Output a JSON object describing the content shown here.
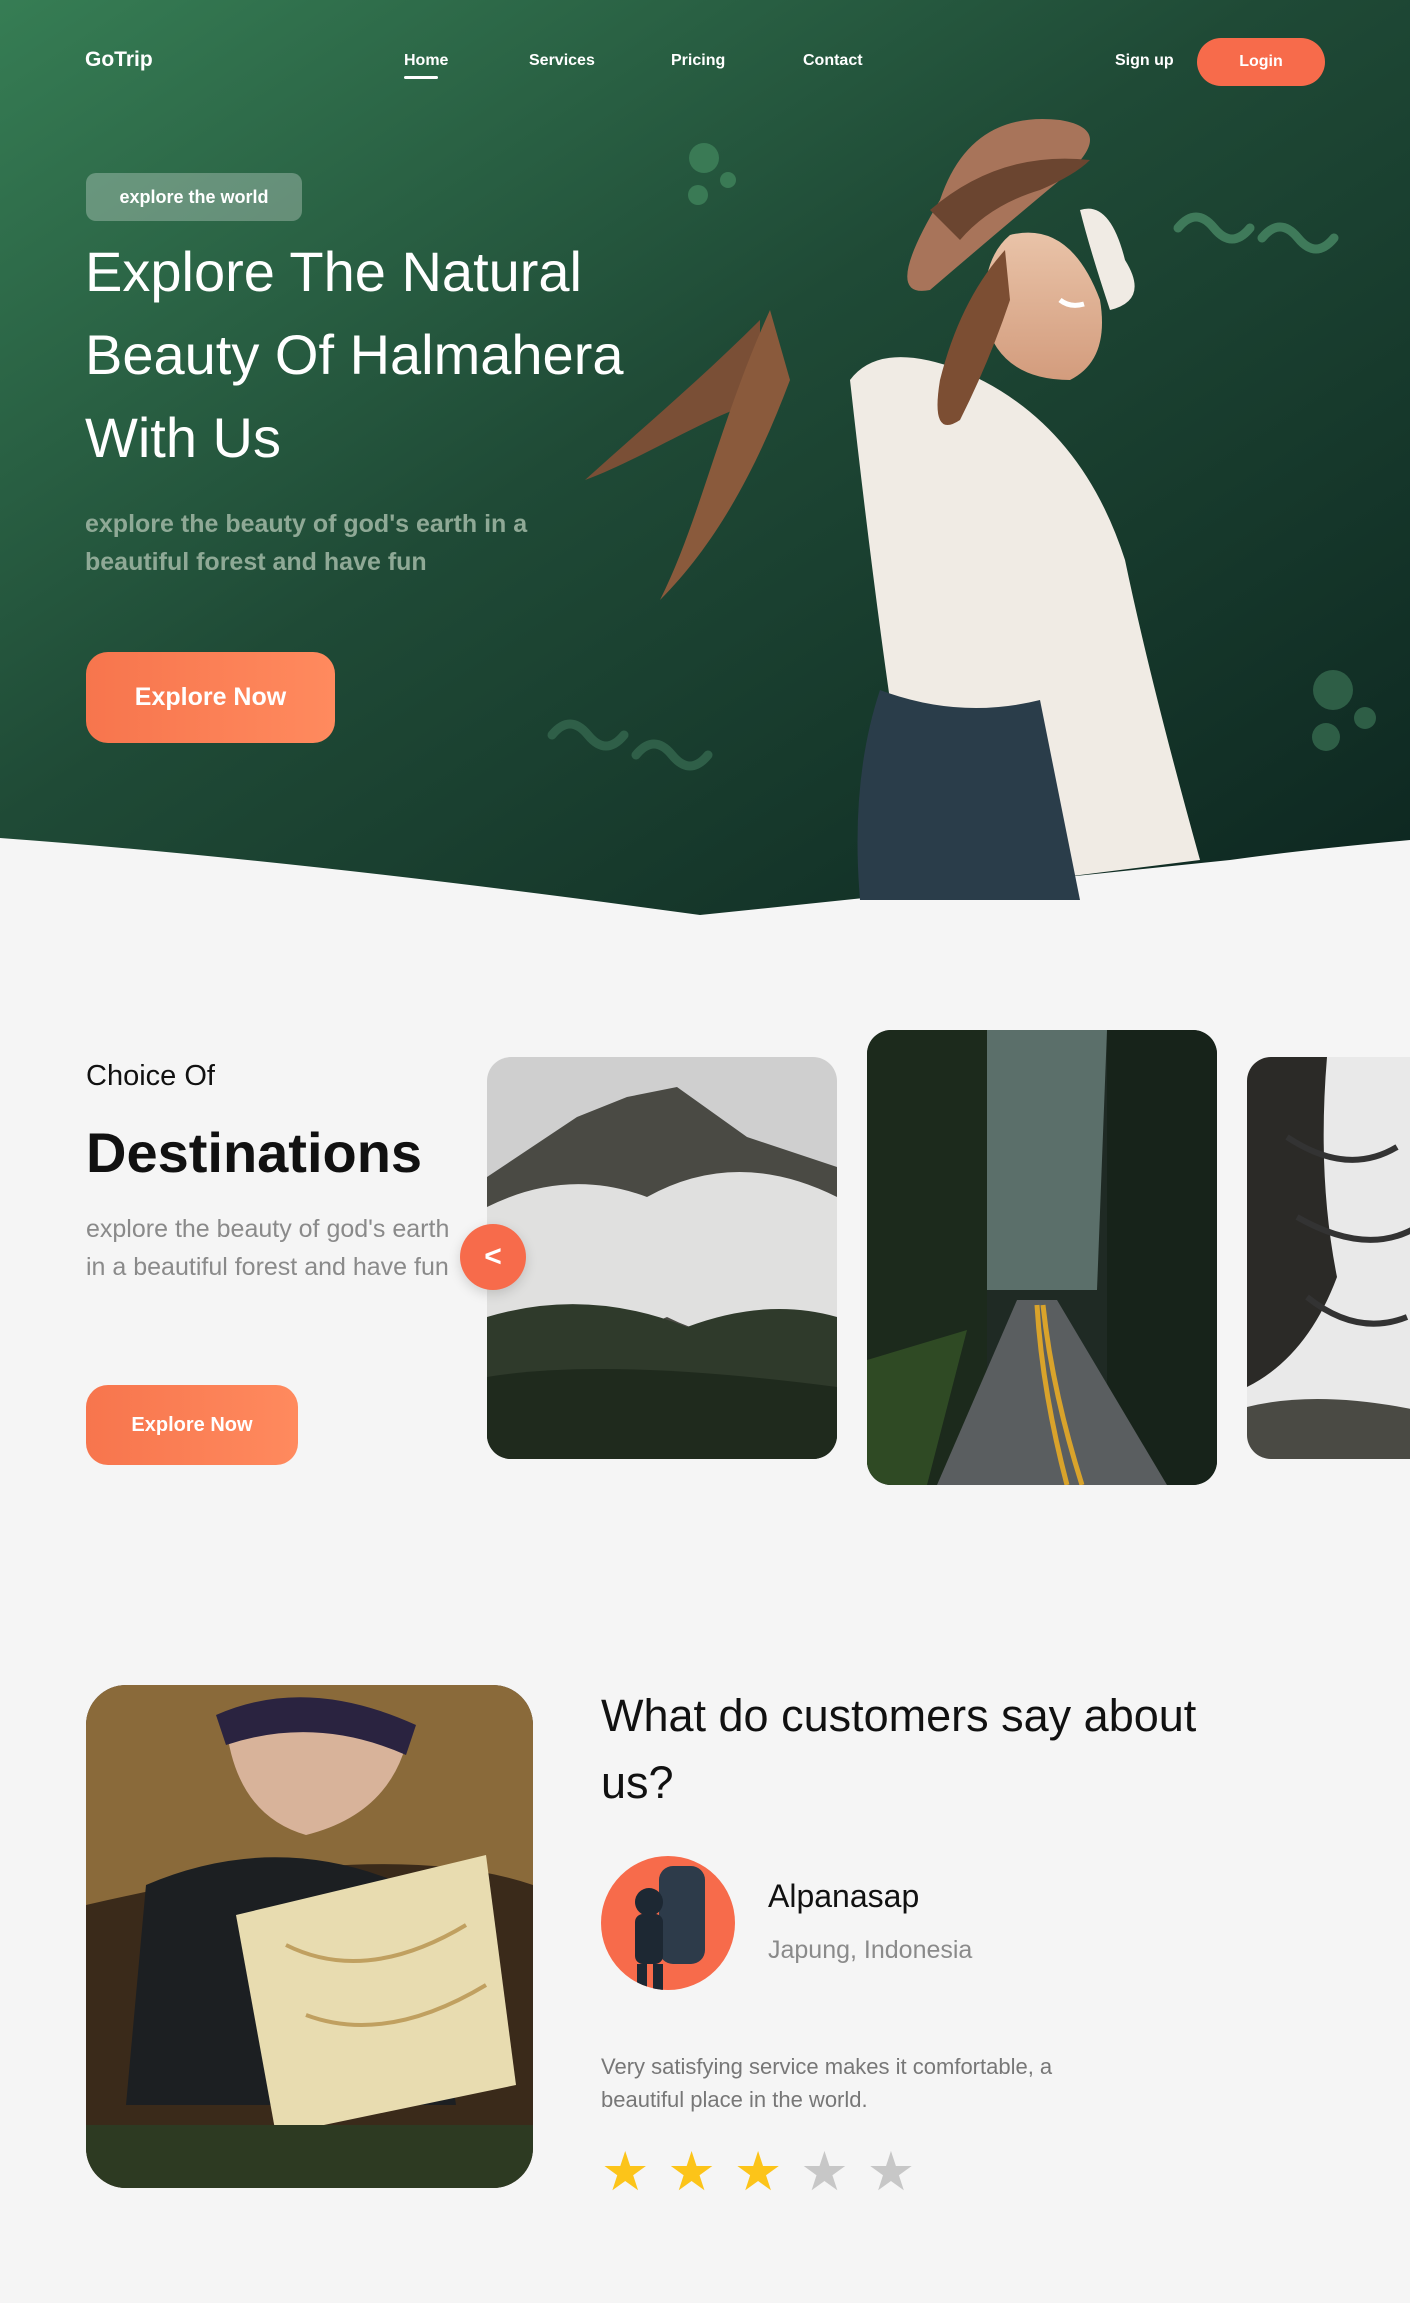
{
  "colors": {
    "accent": "#f76b4b",
    "hero_dark": "#0f2a22",
    "hero_light": "#347a52",
    "star_on": "#fcc419",
    "star_off": "#c7c7c7"
  },
  "nav": {
    "logo": "GoTrip",
    "links": [
      "Home",
      "Services",
      "Pricing",
      "Contact"
    ],
    "active": "Home",
    "signup": "Sign up",
    "login": "Login"
  },
  "hero": {
    "badge": "explore the world",
    "title": "Explore The Natural Beauty Of Halmahera With Us",
    "subtitle": "explore the beauty of god's earth in a beautiful forest and have fun",
    "cta": "Explore Now"
  },
  "destinations": {
    "pretitle": "Choice Of",
    "title": "Destinations",
    "description": "explore the beauty of god's earth in a beautiful forest and have fun",
    "cta": "Explore Now",
    "prev_icon": "chevron-left-icon",
    "prev_glyph": "<",
    "cards": [
      "misty-mountain-photo",
      "forest-road-photo",
      "foggy-trees-photo"
    ]
  },
  "testimonial": {
    "title": "What do customers say about us?",
    "reviewer_name": "Alpanasap",
    "reviewer_location": "Japung, Indonesia",
    "review": "Very satisfying service makes it comfortable, a beautiful place in the world.",
    "rating": 3,
    "max_rating": 5,
    "star_glyph": "★"
  }
}
